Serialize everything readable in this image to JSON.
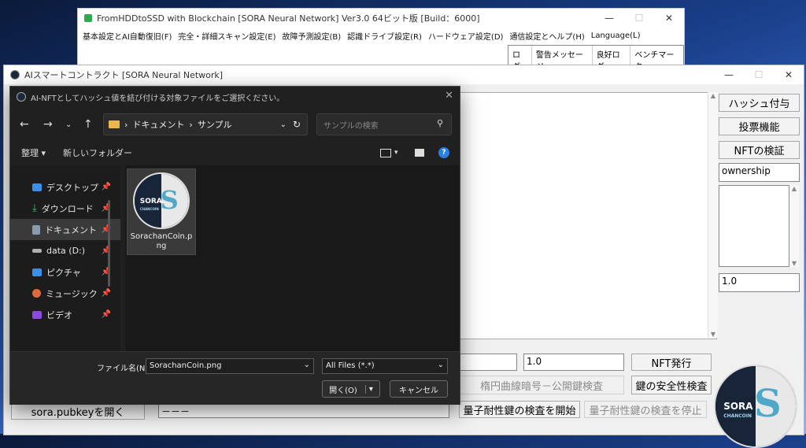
{
  "main_window": {
    "title": "FromHDDtoSSD with Blockchain [SORA Neural Network] Ver3.0 64ビット版 [Build：6000]",
    "menu": [
      "基本設定とAI自動復旧(F)",
      "完全・詳細スキャン設定(E)",
      "故障予測設定(B)",
      "認識ドライブ設定(R)",
      "ハードウェア設定(D)",
      "通信設定とヘルプ(H)",
      "Language(L)"
    ],
    "log_tabs": [
      "ログ",
      "警告メッセージ",
      "良好ログ",
      "ベンチマーク"
    ]
  },
  "ai_window": {
    "title": "AIスマートコントラクト [SORA Neural Network]",
    "buttons": {
      "hash": "ハッシュ付与",
      "vote": "投票機能",
      "nft_verify": "NFTの検証",
      "nft_issue": "NFT発行",
      "ecc_check": "楕円曲線暗号－公開鍵検査",
      "key_safety": "鍵の安全性検査",
      "quantum_start": "量子耐性鍵の検査を開始",
      "quantum_stop": "量子耐性鍵の検査を停止",
      "open_pubkey": "sora.pubkeyを開く"
    },
    "ownership_field": "ownership",
    "value_field_right": "1.0",
    "value_field_bottom": "1.0",
    "dash_field": "－－－"
  },
  "dialog": {
    "title": "AI-NFTとしてハッシュ値を結び付ける対象ファイルをご選択ください。",
    "path": [
      "ドキュメント",
      "サンプル"
    ],
    "search_placeholder": "サンプルの検索",
    "cmd": {
      "organize": "整理",
      "new_folder": "新しいフォルダー"
    },
    "sidebar": [
      {
        "label": "デスクトップ",
        "icon": "desktop-icon",
        "color": "#3a8ee6"
      },
      {
        "label": "ダウンロード",
        "icon": "download-icon",
        "color": "#3ac46e"
      },
      {
        "label": "ドキュメント",
        "icon": "document-icon",
        "color": "#8a9bb0",
        "selected": true
      },
      {
        "label": "data (D:)",
        "icon": "drive-icon",
        "color": "#b0b0b0"
      },
      {
        "label": "ピクチャ",
        "icon": "pictures-icon",
        "color": "#3a8ee6"
      },
      {
        "label": "ミュージック",
        "icon": "music-icon",
        "color": "#e06a3a"
      },
      {
        "label": "ビデオ",
        "icon": "video-icon",
        "color": "#8a4ae0"
      }
    ],
    "file": {
      "name": "SorachanCoin.png"
    },
    "filename_label": "ファイル名(N):",
    "filename_value": "SorachanCoin.png",
    "filter": "All Files (*.*)",
    "open": "開く(O)",
    "cancel": "キャンセル"
  },
  "coin_logo": {
    "top": "SORA",
    "bottom": "CHANCOIN",
    "letter": "S"
  }
}
